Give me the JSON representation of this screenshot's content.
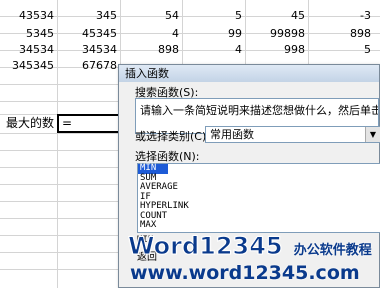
{
  "rows": [
    [
      "43534",
      "345",
      "54",
      "5",
      "45",
      "-3"
    ],
    [
      "5345",
      "45345",
      "4",
      "99",
      "99898",
      "898"
    ],
    [
      "34534",
      "34534",
      "898",
      "4",
      "998",
      "5"
    ],
    [
      "345345",
      "67678",
      "",
      "",
      "",
      ""
    ]
  ],
  "max_label": "最大的数",
  "formula": "=",
  "dialog": {
    "title": "插入函数",
    "search_label": "搜索函数(S):",
    "search_text": "请输入一条简短说明来描述您想做什么，然后单击“转到”",
    "category_label": "或选择类别(C):",
    "category_value": "常用函数",
    "select_label": "选择函数(N):",
    "functions": [
      "MIN",
      "SUM",
      "AVERAGE",
      "IF",
      "HYPERLINK",
      "COUNT",
      "MAX"
    ],
    "syntax": "MIN",
    "return_text": "返回"
  },
  "watermark": {
    "brand": "Word12345",
    "tagline": "办公软件教程",
    "url": "www.word12345.com"
  }
}
